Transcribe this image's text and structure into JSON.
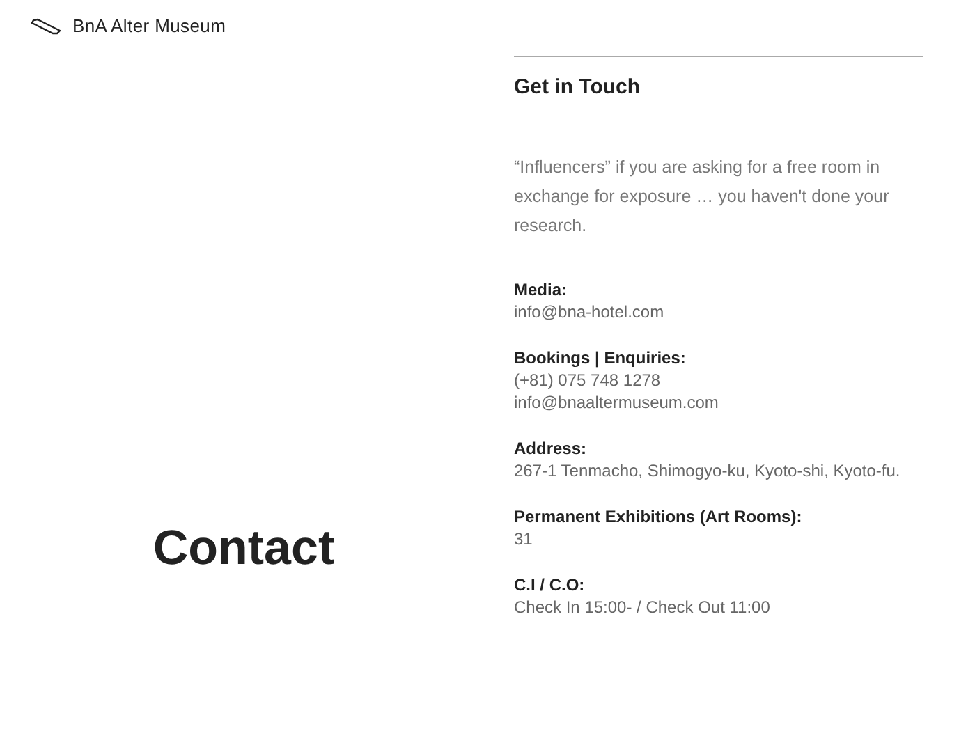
{
  "header": {
    "brand": "BnA Alter Museum"
  },
  "page_title": "Contact",
  "contact": {
    "title": "Get in Touch",
    "intro": "“Influencers” if you are asking for a free room in exchange for exposure … you haven't done your research.",
    "sections": [
      {
        "label": "Media:",
        "lines": [
          "info@bna-hotel.com"
        ]
      },
      {
        "label": "Bookings | Enquiries:",
        "lines": [
          "(+81) 075 748 1278",
          "info@bnaaltermuseum.com"
        ]
      },
      {
        "label": "Address:",
        "lines": [
          "267-1 Tenmacho, Shimogyo-ku, Kyoto-shi, Kyoto-fu."
        ]
      },
      {
        "label": "Permanent Exhibitions (Art Rooms):",
        "lines": [
          "31"
        ]
      },
      {
        "label": "C.I / C.O:",
        "lines": [
          "Check In 15:00- / Check Out 11:00"
        ]
      }
    ]
  }
}
